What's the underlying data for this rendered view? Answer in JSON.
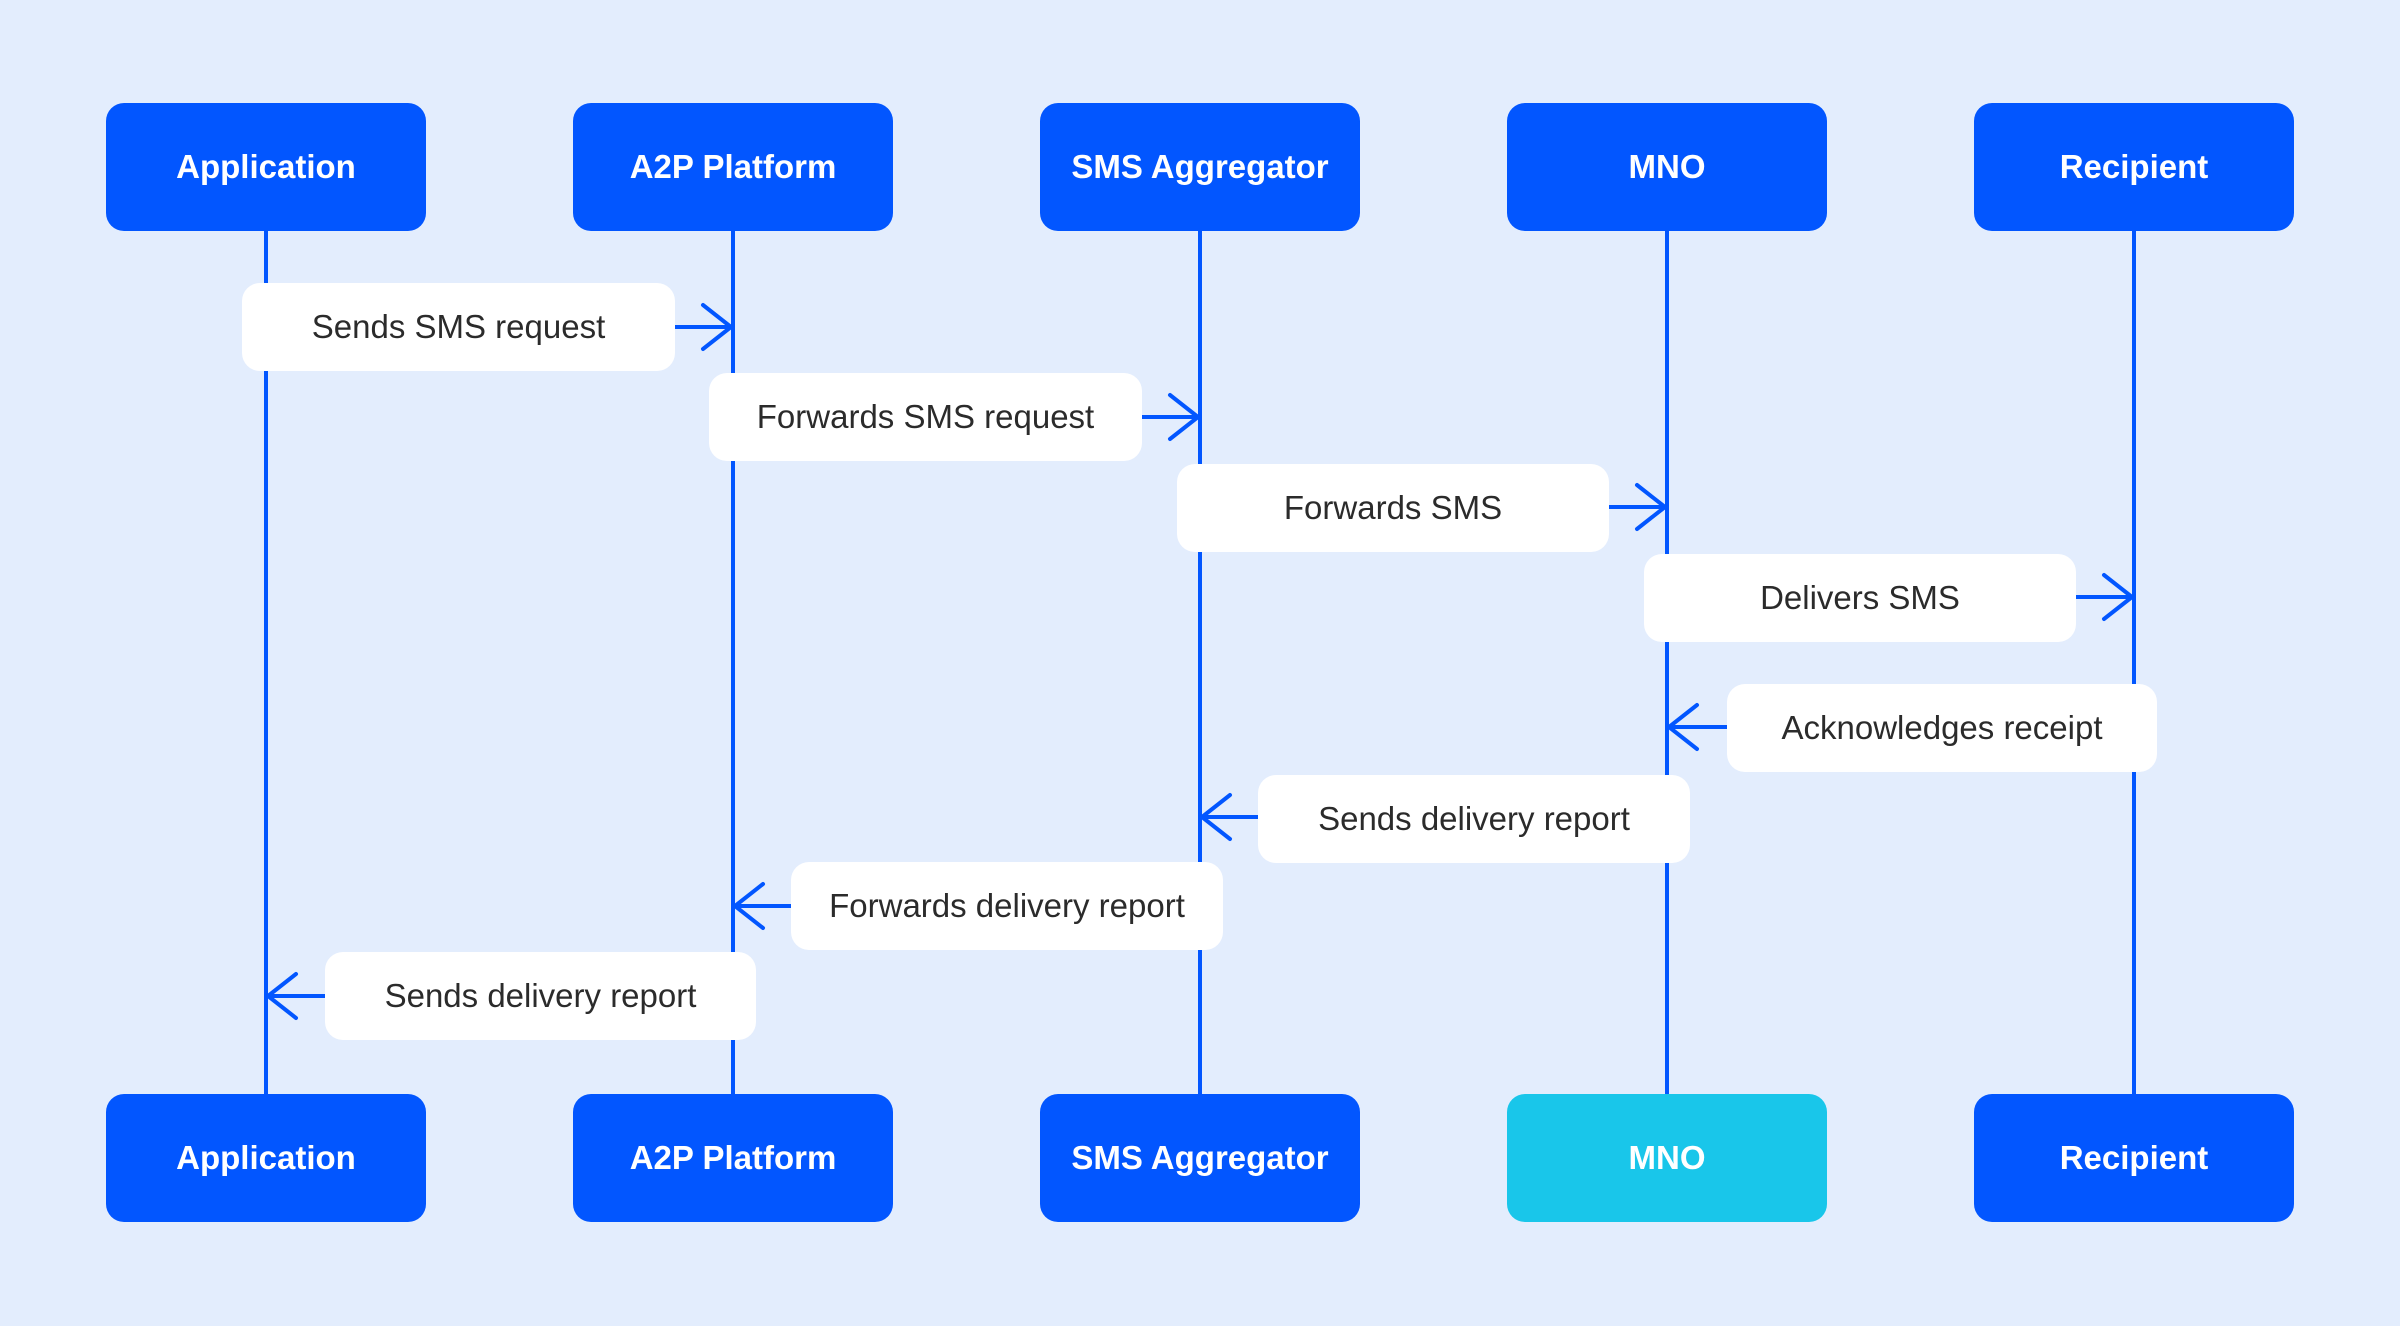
{
  "colors": {
    "background": "#e3edfd",
    "actor": "#0256ff",
    "actor_highlight": "#19c6ea",
    "lifeline": "#0256ff",
    "message_bg": "#ffffff",
    "message_text": "#2b2b2b"
  },
  "actors": [
    {
      "id": "application",
      "label": "Application"
    },
    {
      "id": "a2p-platform",
      "label": "A2P Platform"
    },
    {
      "id": "sms-aggregator",
      "label": "SMS Aggregator"
    },
    {
      "id": "mno",
      "label": "MNO"
    },
    {
      "id": "recipient",
      "label": "Recipient"
    }
  ],
  "bottom_actors": [
    {
      "id": "application",
      "label": "Application",
      "highlighted": false
    },
    {
      "id": "a2p-platform",
      "label": "A2P Platform",
      "highlighted": false
    },
    {
      "id": "sms-aggregator",
      "label": "SMS Aggregator",
      "highlighted": false
    },
    {
      "id": "mno",
      "label": "MNO",
      "highlighted": true
    },
    {
      "id": "recipient",
      "label": "Recipient",
      "highlighted": false
    }
  ],
  "messages": [
    {
      "from": "application",
      "to": "a2p-platform",
      "label": "Sends SMS request",
      "direction": "right"
    },
    {
      "from": "a2p-platform",
      "to": "sms-aggregator",
      "label": "Forwards SMS request",
      "direction": "right"
    },
    {
      "from": "sms-aggregator",
      "to": "mno",
      "label": "Forwards SMS",
      "direction": "right"
    },
    {
      "from": "mno",
      "to": "recipient",
      "label": "Delivers SMS",
      "direction": "right"
    },
    {
      "from": "recipient",
      "to": "mno",
      "label": "Acknowledges receipt",
      "direction": "left"
    },
    {
      "from": "mno",
      "to": "sms-aggregator",
      "label": "Sends delivery report",
      "direction": "left"
    },
    {
      "from": "sms-aggregator",
      "to": "a2p-platform",
      "label": "Forwards delivery report",
      "direction": "left"
    },
    {
      "from": "a2p-platform",
      "to": "application",
      "label": "Sends delivery report",
      "direction": "left"
    }
  ]
}
